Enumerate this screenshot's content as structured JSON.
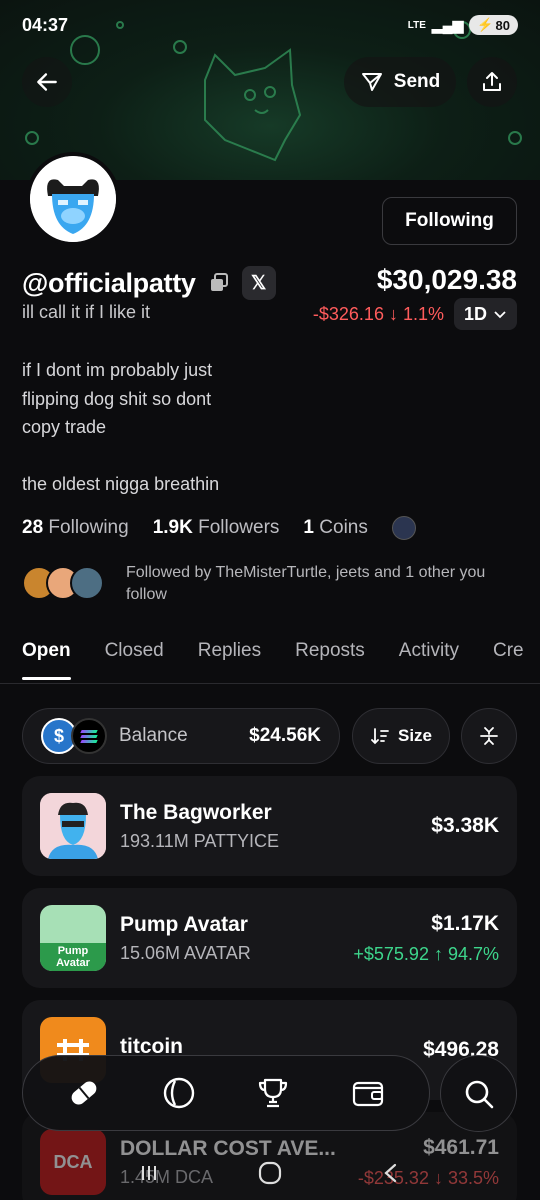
{
  "status": {
    "time": "04:37",
    "network": "LTE",
    "battery": "80"
  },
  "header": {
    "send_label": "Send"
  },
  "profile": {
    "handle": "@officialpatty",
    "x_label": "𝕏",
    "tagline": "ill call it if I like it",
    "balance": "$30,029.38",
    "change": "-$326.16 ↓ 1.1%",
    "period": "1D",
    "follow_button": "Following",
    "bio_lines": [
      "if I dont im probably just",
      "flipping dog shit so dont",
      "copy trade",
      "",
      "the oldest nigga breathin"
    ],
    "stats": {
      "following_count": "28",
      "following_label": "Following",
      "followers_count": "1.9K",
      "followers_label": "Followers",
      "coins_count": "1",
      "coins_label": "Coins"
    },
    "followed_by": "Followed by TheMisterTurtle, jeets and 1 other you follow"
  },
  "tabs": [
    "Open",
    "Closed",
    "Replies",
    "Reposts",
    "Activity",
    "Cre"
  ],
  "balance_pill": {
    "label": "Balance",
    "value": "$24.56K",
    "size_label": "Size"
  },
  "holdings": [
    {
      "name": "The Bagworker",
      "amount": "193.11M PATTYICE",
      "value": "$3.38K",
      "pnl": ""
    },
    {
      "name": "Pump Avatar",
      "amount": "15.06M AVATAR",
      "value": "$1.17K",
      "pnl": "+$575.92 ↑ 94.7%"
    },
    {
      "name": "titcoin",
      "amount": "",
      "value": "$496.28",
      "pnl": ""
    },
    {
      "name": "DOLLAR COST AVE...",
      "amount": "1.45M DCA",
      "value": "$461.71",
      "pnl": "-$235.32 ↓ 33.5%",
      "thumb_text": "DCA"
    }
  ],
  "thumb_texts": {
    "pump": "Pump\nAvatar"
  },
  "colors": {
    "positive": "#3dd68c",
    "negative": "#ff5c5c",
    "background": "#0c0c0e",
    "card": "#17171a"
  },
  "icons": [
    "back-arrow-icon",
    "send-icon",
    "share-icon",
    "copy-icon",
    "x-logo-icon",
    "chevron-down-icon",
    "sort-icon",
    "collapse-icon",
    "pill-icon",
    "circle-icon",
    "trophy-icon",
    "wallet-icon",
    "search-icon"
  ]
}
